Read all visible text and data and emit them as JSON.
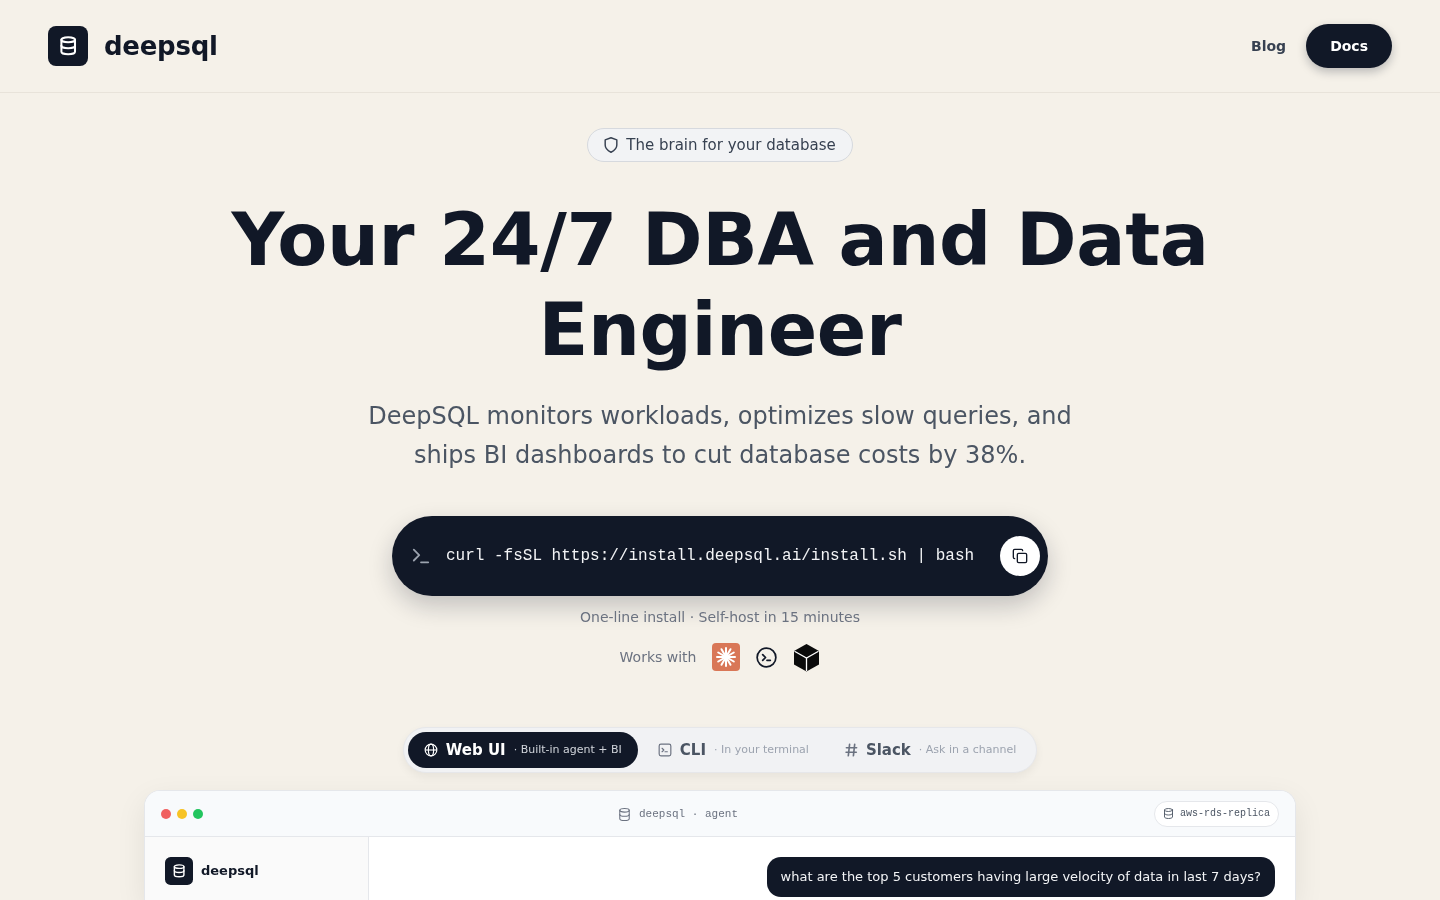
{
  "header": {
    "brand": "deepsql",
    "nav": [
      {
        "label": "Blog",
        "kind": "link"
      },
      {
        "label": "Docs",
        "kind": "button"
      }
    ]
  },
  "hero": {
    "badge": "The brain for your database",
    "title": "Your 24/7 DBA and Data Engineer",
    "subtitle": "DeepSQL monitors workloads, optimizes slow queries, and ships BI dashboards to cut database costs by 38%.",
    "install_command": "curl -fsSL https://install.deepsql.ai/install.sh | bash",
    "install_note": "One-line install · Self-host in 15 minutes",
    "works_with_label": "Works with"
  },
  "tabs": [
    {
      "kind": "web",
      "label": "Web UI",
      "caption": "· Built-in agent + BI",
      "selected": true
    },
    {
      "kind": "terminal",
      "label": "CLI",
      "caption": "· In your terminal",
      "selected": false
    },
    {
      "kind": "channel",
      "label": "Slack",
      "caption": "· Ask in a channel",
      "selected": false
    }
  ],
  "app_window": {
    "title": "deepsql · agent",
    "connection": "aws-rds-replica",
    "sidebar_brand": "deepsql",
    "user_message": "what are the top 5 customers having large velocity of data in last 7 days?"
  }
}
